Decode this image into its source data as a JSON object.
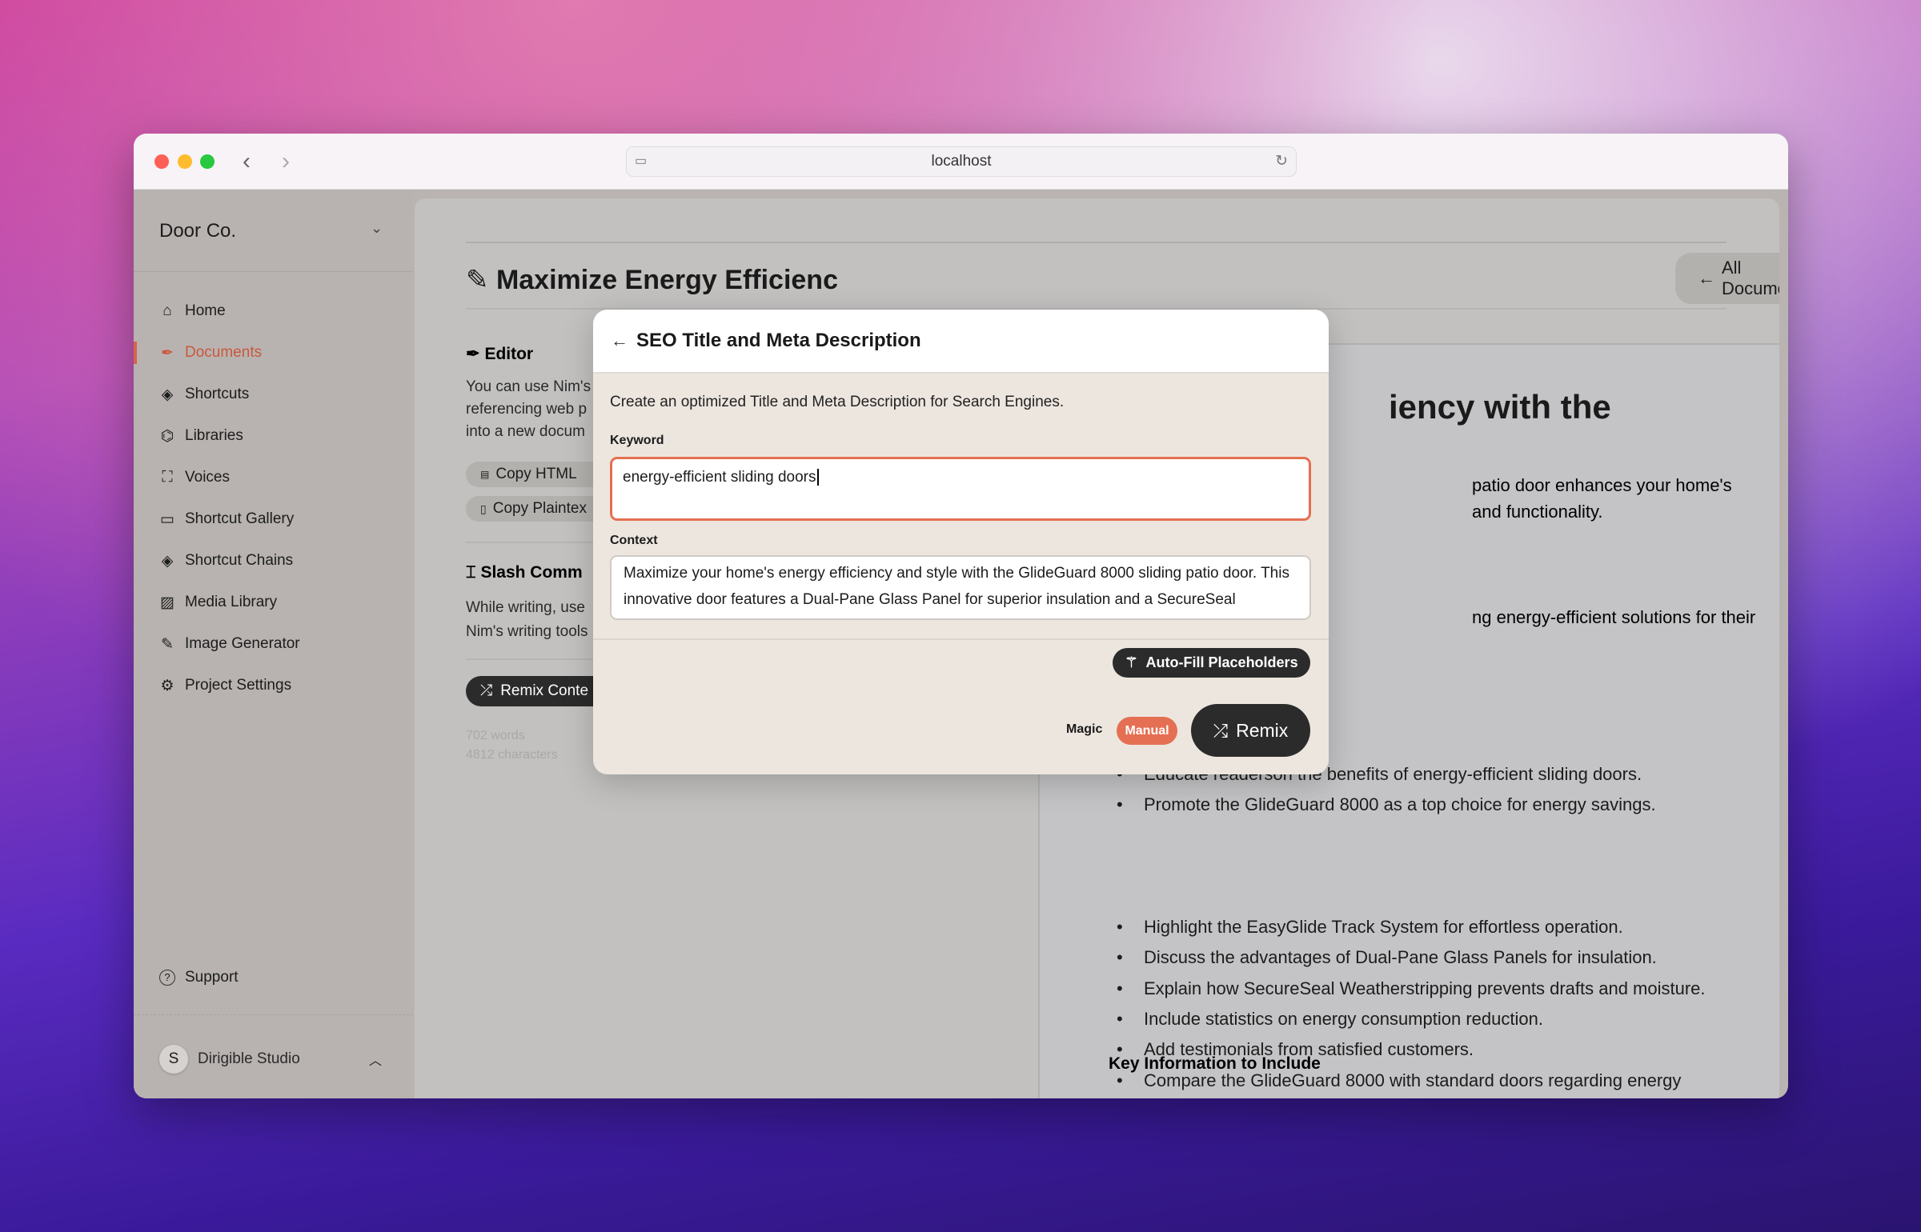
{
  "browser": {
    "url": "localhost"
  },
  "sidebar": {
    "workspace": "Door Co.",
    "items": [
      {
        "label": "Home",
        "icon": "home-icon"
      },
      {
        "label": "Documents",
        "icon": "pen-icon",
        "active": true
      },
      {
        "label": "Shortcuts",
        "icon": "layers-plus-icon"
      },
      {
        "label": "Libraries",
        "icon": "graduation-cap-icon"
      },
      {
        "label": "Voices",
        "icon": "face-scan-icon"
      },
      {
        "label": "Shortcut Gallery",
        "icon": "gallery-icon"
      },
      {
        "label": "Shortcut Chains",
        "icon": "layers-icon"
      },
      {
        "label": "Media Library",
        "icon": "image-icon"
      },
      {
        "label": "Image Generator",
        "icon": "brush-icon"
      },
      {
        "label": "Project Settings",
        "icon": "gear-icon"
      }
    ],
    "support": "Support",
    "user": {
      "initial": "S",
      "name": "Dirigible Studio"
    }
  },
  "page": {
    "title": "Maximize Energy Efficienc",
    "all_documents": "All Documents",
    "editor": {
      "heading": "Editor",
      "lines": [
        "You can use Nim's",
        "referencing web p",
        "into a new docum"
      ],
      "copy_html": "Copy HTML",
      "copy_plaintext": "Copy Plaintex"
    },
    "slash": {
      "heading": "Slash Comm",
      "lines": [
        "While writing, use",
        "Nim's writing tools"
      ]
    },
    "remix_content": "Remix Conte",
    "words": "702 words",
    "characters": "4812 characters"
  },
  "document": {
    "heading_fragment": "iency with the",
    "fragments": [
      "patio door enhances your home's",
      "and functionality.",
      "ng energy-efficient solutions for their"
    ],
    "goal_bullets": [
      "Educate readerson the benefits of energy-efficient sliding doors.",
      "Promote the GlideGuard 8000 as a top choice for energy savings."
    ],
    "key_heading": "Key Information to Include",
    "key_bullets": [
      "Highlight the EasyGlide Track System for effortless operation.",
      "Discuss the advantages of Dual-Pane Glass Panels for insulation.",
      "Explain how SecureSeal Weatherstripping prevents drafts and moisture.",
      "Include statistics on energy consumption reduction.",
      "Add testimonials from satisfied customers.",
      "Compare the GlideGuard 8000 with standard doors regarding energy"
    ]
  },
  "modal": {
    "title": "SEO Title and Meta Description",
    "description": "Create an optimized Title and Meta Description for Search Engines.",
    "keyword_label": "Keyword",
    "keyword_value": "energy-efficient sliding doors",
    "context_label": "Context",
    "context_value": "Maximize your home's energy efficiency and style with the GlideGuard 8000 sliding patio door. This innovative door features a Dual-Pane Glass Panel for superior insulation and a SecureSeal",
    "autofill": "Auto-Fill Placeholders",
    "magic": "Magic",
    "manual": "Manual",
    "remix": "Remix"
  },
  "colors": {
    "accent": "#e56f52",
    "active_nav": "#c9583e",
    "dark_button": "#2b2b2b"
  },
  "scroll_progress": 0.55
}
